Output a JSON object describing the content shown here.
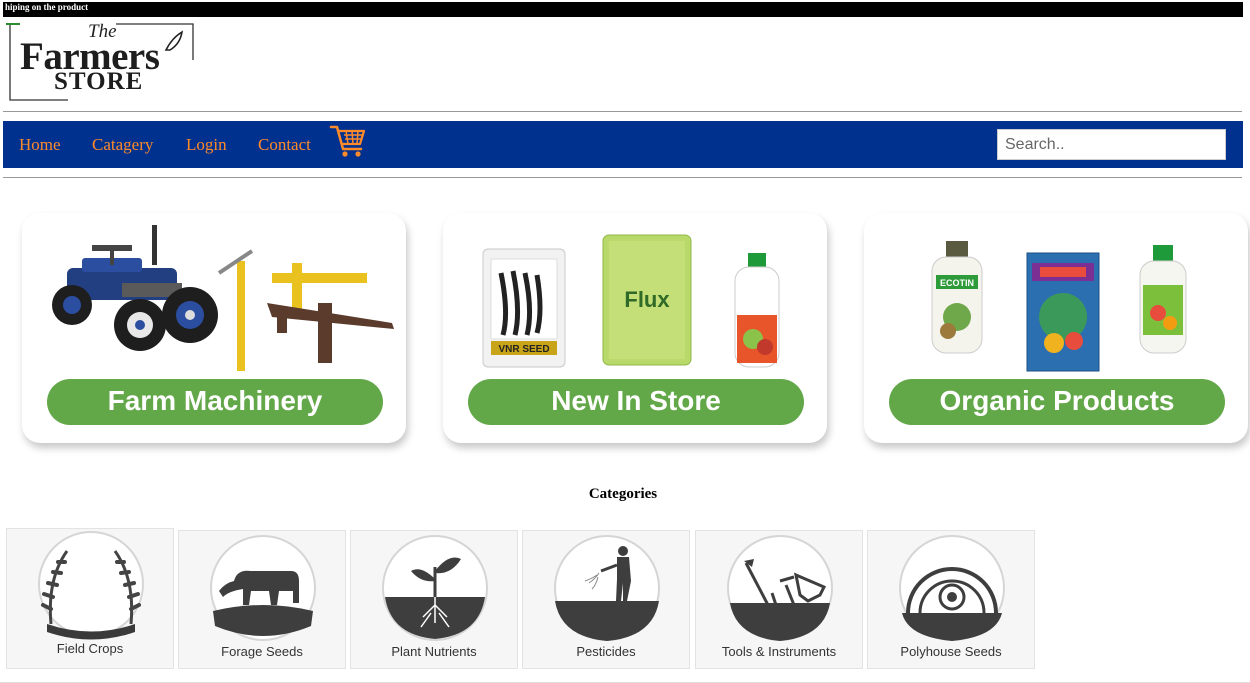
{
  "top_banner": {
    "text": "hiping on the product"
  },
  "logo": {
    "the": "The",
    "farmers": "Farmers",
    "store": "STORE"
  },
  "nav": {
    "items": [
      {
        "label": "Home"
      },
      {
        "label": "Catagery"
      },
      {
        "label": "Login"
      },
      {
        "label": "Contact"
      }
    ],
    "cart_icon": "cart-icon",
    "search_placeholder": "Search.."
  },
  "promo_cards": [
    {
      "label": "Farm Machinery"
    },
    {
      "label": "New In Store"
    },
    {
      "label": "Organic Products"
    }
  ],
  "promo_product_text": {
    "seed_pack": "VNR SEED",
    "flux": "Flux",
    "ecotin": "ECOTIN"
  },
  "categories": {
    "heading": "Categories",
    "items": [
      {
        "label": "Field Crops",
        "icon": "wheat-wreath-icon"
      },
      {
        "label": "Forage Seeds",
        "icon": "cow-icon"
      },
      {
        "label": "Plant Nutrients",
        "icon": "sprout-icon"
      },
      {
        "label": "Pesticides",
        "icon": "farmer-spraying-icon"
      },
      {
        "label": "Tools & Instruments",
        "icon": "tools-icon"
      },
      {
        "label": "Polyhouse Seeds",
        "icon": "polyhouse-icon"
      }
    ]
  },
  "colors": {
    "nav_background": "#00318f",
    "nav_link": "#ff8a2a",
    "pill_green": "#62a748",
    "top_banner": "#000000"
  }
}
